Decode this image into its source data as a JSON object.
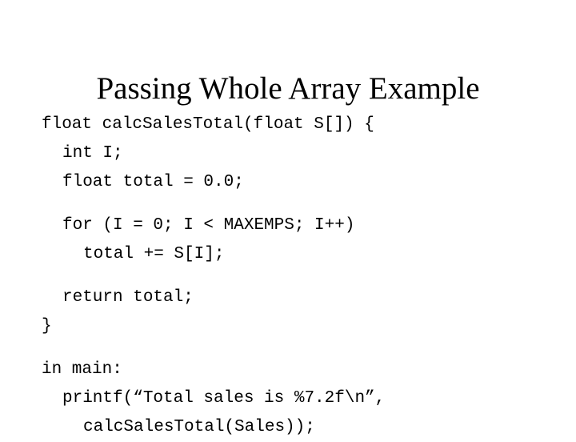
{
  "slide": {
    "title": "Passing Whole Array Example",
    "background_color": "#ffffff",
    "text_color": "#000000",
    "code": {
      "language": "c",
      "lines": [
        {
          "text": "float calcSalesTotal(float S[]) {",
          "indent": 0,
          "gap_before": false
        },
        {
          "text": "int I;",
          "indent": 1,
          "gap_before": false
        },
        {
          "text": "float total = 0.0;",
          "indent": 1,
          "gap_before": false
        },
        {
          "text": "for (I = 0; I < MAXEMPS; I++)",
          "indent": 1,
          "gap_before": true
        },
        {
          "text": "total += S[I];",
          "indent": 2,
          "gap_before": false
        },
        {
          "text": "return total;",
          "indent": 1,
          "gap_before": true
        },
        {
          "text": "}",
          "indent": 0,
          "gap_before": false
        },
        {
          "text": "in main:",
          "indent": 0,
          "gap_before": true
        },
        {
          "text": "printf(“Total sales is %7.2f\\n”,",
          "indent": 1,
          "gap_before": false
        },
        {
          "text": "calcSalesTotal(Sales));",
          "indent": 2,
          "gap_before": false
        }
      ]
    }
  }
}
